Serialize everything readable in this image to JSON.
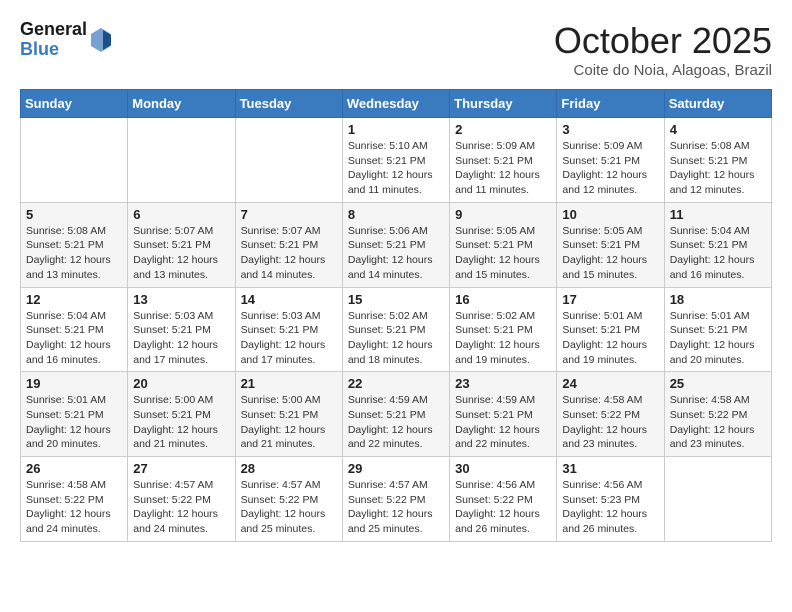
{
  "header": {
    "logo_general": "General",
    "logo_blue": "Blue",
    "month": "October 2025",
    "location": "Coite do Noia, Alagoas, Brazil"
  },
  "days_of_week": [
    "Sunday",
    "Monday",
    "Tuesday",
    "Wednesday",
    "Thursday",
    "Friday",
    "Saturday"
  ],
  "weeks": [
    [
      {
        "day": "",
        "info": ""
      },
      {
        "day": "",
        "info": ""
      },
      {
        "day": "",
        "info": ""
      },
      {
        "day": "1",
        "info": "Sunrise: 5:10 AM\nSunset: 5:21 PM\nDaylight: 12 hours\nand 11 minutes."
      },
      {
        "day": "2",
        "info": "Sunrise: 5:09 AM\nSunset: 5:21 PM\nDaylight: 12 hours\nand 11 minutes."
      },
      {
        "day": "3",
        "info": "Sunrise: 5:09 AM\nSunset: 5:21 PM\nDaylight: 12 hours\nand 12 minutes."
      },
      {
        "day": "4",
        "info": "Sunrise: 5:08 AM\nSunset: 5:21 PM\nDaylight: 12 hours\nand 12 minutes."
      }
    ],
    [
      {
        "day": "5",
        "info": "Sunrise: 5:08 AM\nSunset: 5:21 PM\nDaylight: 12 hours\nand 13 minutes."
      },
      {
        "day": "6",
        "info": "Sunrise: 5:07 AM\nSunset: 5:21 PM\nDaylight: 12 hours\nand 13 minutes."
      },
      {
        "day": "7",
        "info": "Sunrise: 5:07 AM\nSunset: 5:21 PM\nDaylight: 12 hours\nand 14 minutes."
      },
      {
        "day": "8",
        "info": "Sunrise: 5:06 AM\nSunset: 5:21 PM\nDaylight: 12 hours\nand 14 minutes."
      },
      {
        "day": "9",
        "info": "Sunrise: 5:05 AM\nSunset: 5:21 PM\nDaylight: 12 hours\nand 15 minutes."
      },
      {
        "day": "10",
        "info": "Sunrise: 5:05 AM\nSunset: 5:21 PM\nDaylight: 12 hours\nand 15 minutes."
      },
      {
        "day": "11",
        "info": "Sunrise: 5:04 AM\nSunset: 5:21 PM\nDaylight: 12 hours\nand 16 minutes."
      }
    ],
    [
      {
        "day": "12",
        "info": "Sunrise: 5:04 AM\nSunset: 5:21 PM\nDaylight: 12 hours\nand 16 minutes."
      },
      {
        "day": "13",
        "info": "Sunrise: 5:03 AM\nSunset: 5:21 PM\nDaylight: 12 hours\nand 17 minutes."
      },
      {
        "day": "14",
        "info": "Sunrise: 5:03 AM\nSunset: 5:21 PM\nDaylight: 12 hours\nand 17 minutes."
      },
      {
        "day": "15",
        "info": "Sunrise: 5:02 AM\nSunset: 5:21 PM\nDaylight: 12 hours\nand 18 minutes."
      },
      {
        "day": "16",
        "info": "Sunrise: 5:02 AM\nSunset: 5:21 PM\nDaylight: 12 hours\nand 19 minutes."
      },
      {
        "day": "17",
        "info": "Sunrise: 5:01 AM\nSunset: 5:21 PM\nDaylight: 12 hours\nand 19 minutes."
      },
      {
        "day": "18",
        "info": "Sunrise: 5:01 AM\nSunset: 5:21 PM\nDaylight: 12 hours\nand 20 minutes."
      }
    ],
    [
      {
        "day": "19",
        "info": "Sunrise: 5:01 AM\nSunset: 5:21 PM\nDaylight: 12 hours\nand 20 minutes."
      },
      {
        "day": "20",
        "info": "Sunrise: 5:00 AM\nSunset: 5:21 PM\nDaylight: 12 hours\nand 21 minutes."
      },
      {
        "day": "21",
        "info": "Sunrise: 5:00 AM\nSunset: 5:21 PM\nDaylight: 12 hours\nand 21 minutes."
      },
      {
        "day": "22",
        "info": "Sunrise: 4:59 AM\nSunset: 5:21 PM\nDaylight: 12 hours\nand 22 minutes."
      },
      {
        "day": "23",
        "info": "Sunrise: 4:59 AM\nSunset: 5:21 PM\nDaylight: 12 hours\nand 22 minutes."
      },
      {
        "day": "24",
        "info": "Sunrise: 4:58 AM\nSunset: 5:22 PM\nDaylight: 12 hours\nand 23 minutes."
      },
      {
        "day": "25",
        "info": "Sunrise: 4:58 AM\nSunset: 5:22 PM\nDaylight: 12 hours\nand 23 minutes."
      }
    ],
    [
      {
        "day": "26",
        "info": "Sunrise: 4:58 AM\nSunset: 5:22 PM\nDaylight: 12 hours\nand 24 minutes."
      },
      {
        "day": "27",
        "info": "Sunrise: 4:57 AM\nSunset: 5:22 PM\nDaylight: 12 hours\nand 24 minutes."
      },
      {
        "day": "28",
        "info": "Sunrise: 4:57 AM\nSunset: 5:22 PM\nDaylight: 12 hours\nand 25 minutes."
      },
      {
        "day": "29",
        "info": "Sunrise: 4:57 AM\nSunset: 5:22 PM\nDaylight: 12 hours\nand 25 minutes."
      },
      {
        "day": "30",
        "info": "Sunrise: 4:56 AM\nSunset: 5:22 PM\nDaylight: 12 hours\nand 26 minutes."
      },
      {
        "day": "31",
        "info": "Sunrise: 4:56 AM\nSunset: 5:23 PM\nDaylight: 12 hours\nand 26 minutes."
      },
      {
        "day": "",
        "info": ""
      }
    ]
  ]
}
